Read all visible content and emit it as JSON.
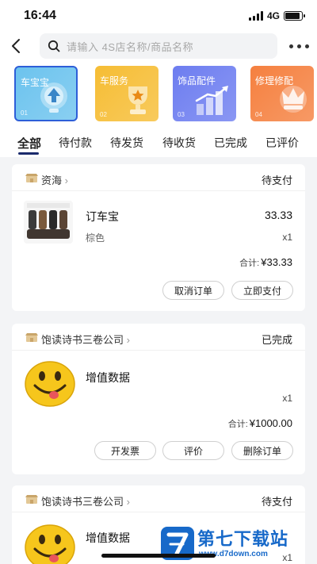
{
  "status_bar": {
    "time": "16:44",
    "network": "4G",
    "battery_level": 0.9
  },
  "nav": {
    "search_placeholder": "请输入 4S店名称/商品名称",
    "back_icon": "chevron-left-icon",
    "search_icon": "search-icon",
    "more_icon": "more-dots-icon"
  },
  "categories": [
    {
      "label": "车宝宝",
      "num": "01",
      "color": "#6cc3ee"
    },
    {
      "label": "车服务",
      "num": "02",
      "color": "#f6bd34"
    },
    {
      "label": "饰品配件",
      "num": "03",
      "color": "#6d7df0"
    },
    {
      "label": "修理修配",
      "num": "04",
      "color": "#f5803f"
    }
  ],
  "tabs": [
    "全部",
    "待付款",
    "待发货",
    "待收货",
    "已完成",
    "已评价"
  ],
  "orders": [
    {
      "shop": "资海",
      "status": "待支付",
      "product": "订车宝",
      "spec": "棕色",
      "price": "33.33",
      "qty": "x1",
      "total_label": "合计:",
      "total": "¥33.33",
      "buttons": [
        "取消订单",
        "立即支付"
      ]
    },
    {
      "shop": "饱读诗书三卷公司",
      "status": "已完成",
      "product": "增值数据",
      "qty": "x1",
      "total_label": "合计:",
      "total": "¥1000.00",
      "buttons": [
        "开发票",
        "评价",
        "删除订单"
      ]
    },
    {
      "shop": "饱读诗书三卷公司",
      "status": "待支付",
      "product": "增值数据",
      "qty": "x1"
    }
  ],
  "watermark": {
    "title": "第七下载站",
    "url": "www.d7down.com"
  }
}
